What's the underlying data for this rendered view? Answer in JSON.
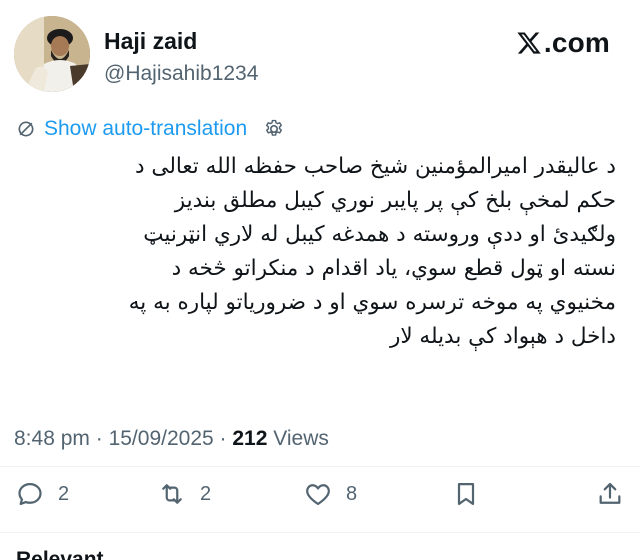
{
  "author": {
    "display_name": "Haji zaid",
    "handle": "@Hajisahib1234"
  },
  "brand": {
    "text": ".com"
  },
  "translation": {
    "label": "Show auto-translation"
  },
  "tweet": {
    "lines": [
      "د عالیقدر امیرالمؤمنین شیخ صاحب حفظه الله تعالی د",
      "حکم لمخې بلخ کې پر پایبر نوري کیبل مطلق بندیز",
      "ولګیدئ او ددې وروسته د همدغه کیبل له لاري انټرنیټ",
      "نسته او ټول قطع سوي، یاد اقدام د منکراتو څخه د",
      "مخنیوي په موخه ترسره سوي او د ضروریاتو لپاره به په",
      "داخل د هېواد کې بدیله لار"
    ]
  },
  "meta": {
    "time": "8:48 pm",
    "separator": "·",
    "date": "15/09/2025",
    "views_count": "212",
    "views_label": "Views"
  },
  "actions": {
    "replies": "2",
    "reposts": "2",
    "likes": "8"
  },
  "footer": {
    "relevant_label": "Relevant ⌄"
  },
  "colors": {
    "accent": "#1d9bf0",
    "secondary_text": "#536471",
    "primary_text": "#0f1419"
  }
}
